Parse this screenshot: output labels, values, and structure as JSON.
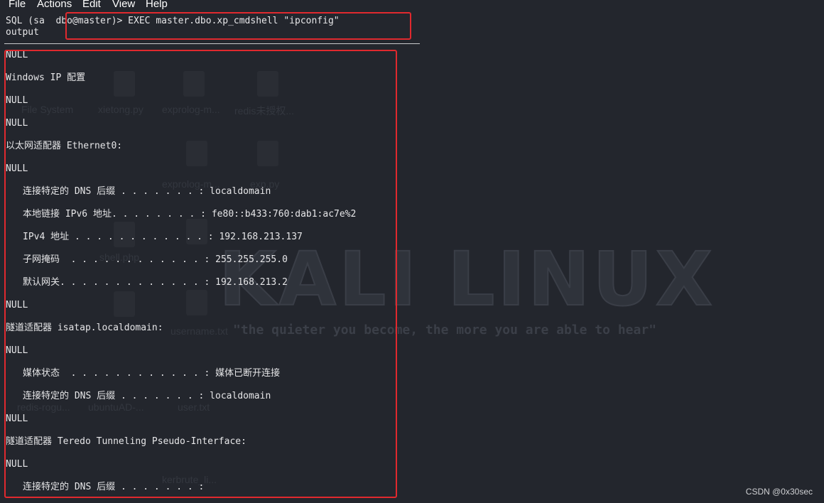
{
  "menu": {
    "items": [
      {
        "label": "File"
      },
      {
        "label": "Actions"
      },
      {
        "label": "Edit"
      },
      {
        "label": "View"
      },
      {
        "label": "Help"
      }
    ]
  },
  "terminal": {
    "prompt": "SQL (sa  dbo@master)> EXEC master.dbo.xp_cmdshell \"ipconfig\"",
    "column_header": "output",
    "lines": [
      "NULL",
      "Windows IP 配置",
      "NULL",
      "NULL",
      "以太网适配器 Ethernet0:",
      "NULL",
      "连接特定的 DNS 后缀 . . . . . . . : localdomain",
      "本地链接 IPv6 地址. . . . . . . . : fe80::b433:760:dab1:ac7e%2",
      "IPv4 地址 . . . . . . . . . . . . : 192.168.213.137",
      "子网掩码  . . . . . . . . . . . . : 255.255.255.0",
      "默认网关. . . . . . . . . . . . . : 192.168.213.2",
      "NULL",
      "隧道适配器 isatap.localdomain:",
      "NULL",
      "媒体状态  . . . . . . . . . . . . : 媒体已断开连接",
      "连接特定的 DNS 后缀 . . . . . . . : localdomain",
      "NULL",
      "隧道适配器 Teredo Tunneling Pseudo-Interface:",
      "NULL",
      "连接特定的 DNS 后缀 . . . . . . . :"
    ]
  },
  "wallpaper": {
    "title": "KALI LINUX",
    "tagline": "\"the quieter you become, the more you are able to hear\"",
    "desktop_labels": [
      "File System",
      "xietong.py",
      "exprolog-m...",
      "redis未授权...",
      "exprolog-m...",
      "shell.php",
      "exp.py",
      "username.txt",
      "redis-rogu...",
      "ubuntuAD-...",
      "user.txt",
      "kerbrute_li..."
    ]
  },
  "watermark": "CSDN @0x30sec",
  "colors": {
    "background": "#23262d",
    "text": "#e6e6e8",
    "highlight": "#e0292e"
  }
}
